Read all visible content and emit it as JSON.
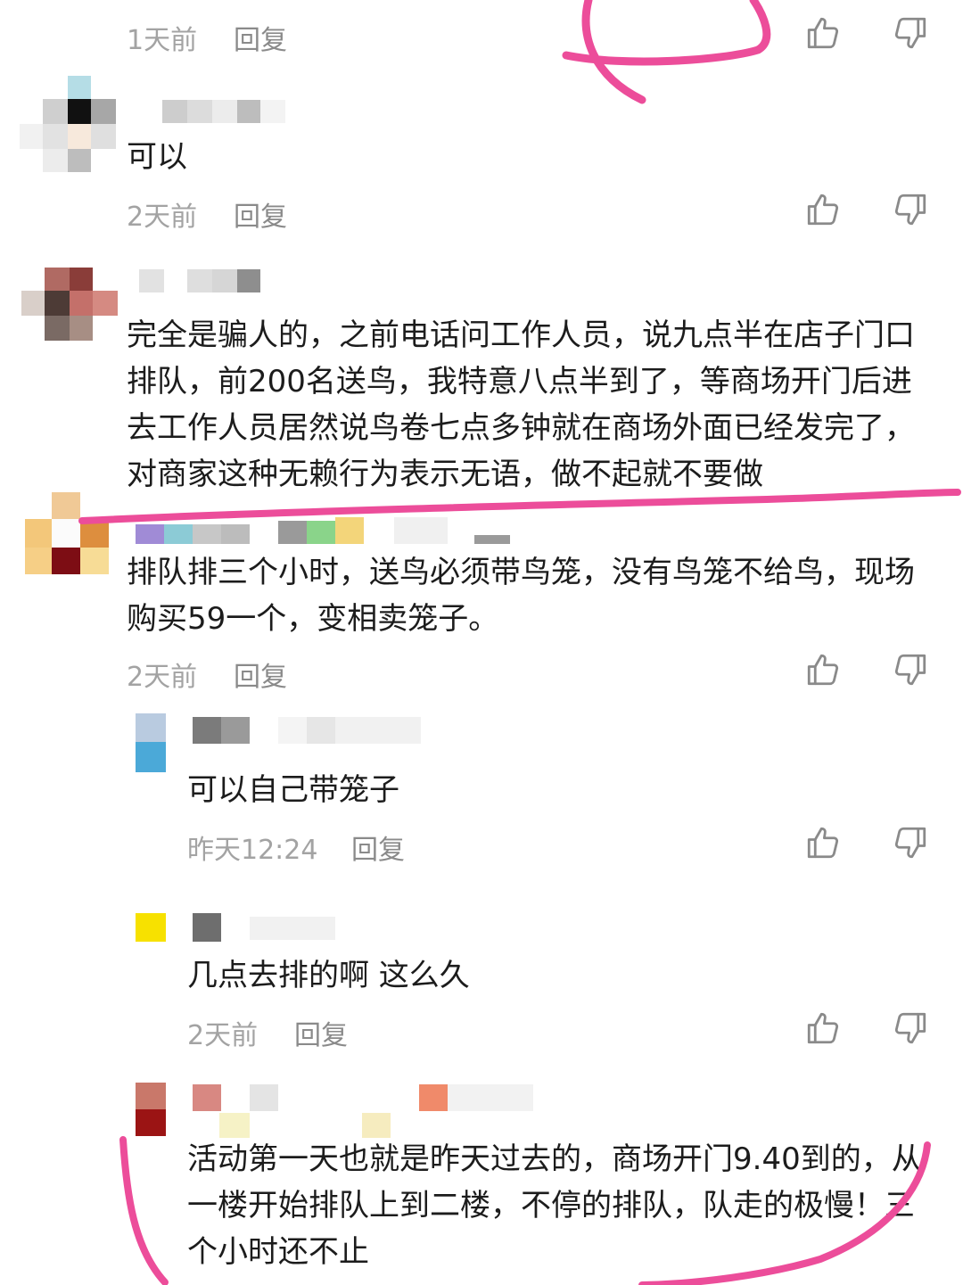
{
  "icons": {
    "like": "thumb-up-icon",
    "dislike": "thumb-down-icon"
  },
  "colors": {
    "annotation": "#ec4d9a",
    "meta": "#a3a3a3",
    "text": "#1c1c1c"
  },
  "comments": [
    {
      "time": "1天前",
      "reply": "回复"
    },
    {
      "text": "可以",
      "time": "2天前",
      "reply": "回复"
    },
    {
      "text": "完全是骗人的，之前电话问工作人员，说九点半在店子门口排队，前200名送鸟，我特意八点半到了，等商场开门后进去工作人员居然说鸟卷七点多钟就在商场外面已经发完了，对商家这种无赖行为表示无语，做不起就不要做"
    },
    {
      "text": "排队排三个小时，送鸟必须带鸟笼，没有鸟笼不给鸟，现场购买59一个，变相卖笼子。",
      "time": "2天前",
      "reply": "回复"
    }
  ],
  "replies": [
    {
      "text": "可以自己带笼子",
      "time": "昨天12:24",
      "reply": "回复"
    },
    {
      "text": "几点去排的啊 这么久",
      "time": "2天前",
      "reply": "回复"
    },
    {
      "text": "活动第一天也就是昨天过去的，商场开门9.40到的，从一楼开始排队上到二楼，不停的排队，队走的极慢！三个小时还不止"
    }
  ]
}
